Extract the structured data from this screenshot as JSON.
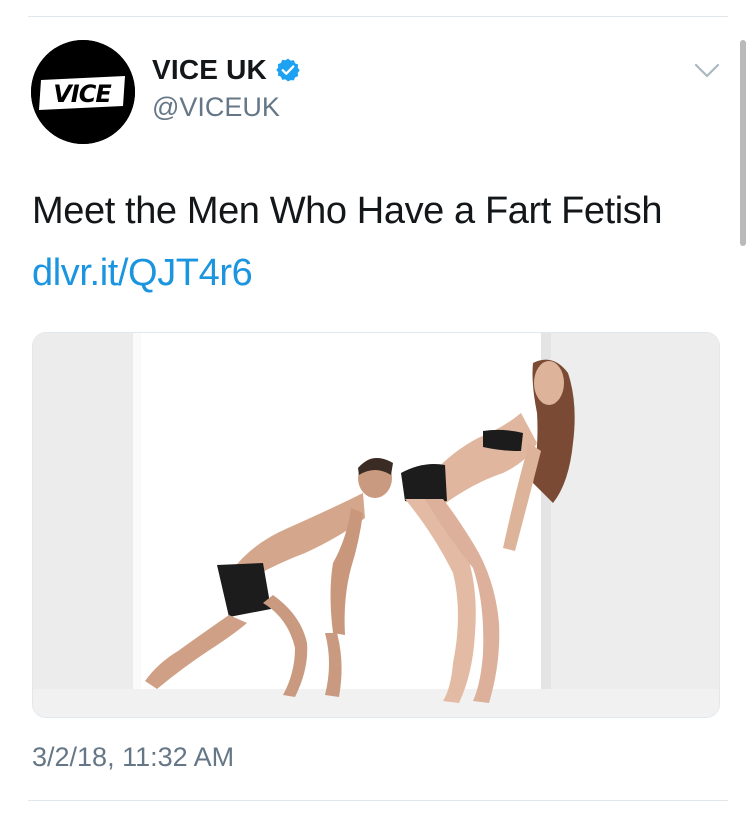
{
  "tweet": {
    "author": {
      "display_name": "VICE UK",
      "handle": "@VICEUK",
      "verified": true,
      "avatar_logo_text": "VICE"
    },
    "text": "Meet the Men Who Have a Fart Fetish",
    "link": "dlvr.it/QJT4r6",
    "timestamp": "3/2/18, 11:32 AM",
    "media": {
      "type": "photo"
    }
  },
  "icons": {
    "verified": "verified-badge-icon",
    "more": "chevron-down-icon"
  },
  "colors": {
    "link": "#1b95e0",
    "verified": "#1da1f2",
    "text_primary": "#14171a",
    "text_secondary": "#657786",
    "divider": "#e1e8ed"
  }
}
